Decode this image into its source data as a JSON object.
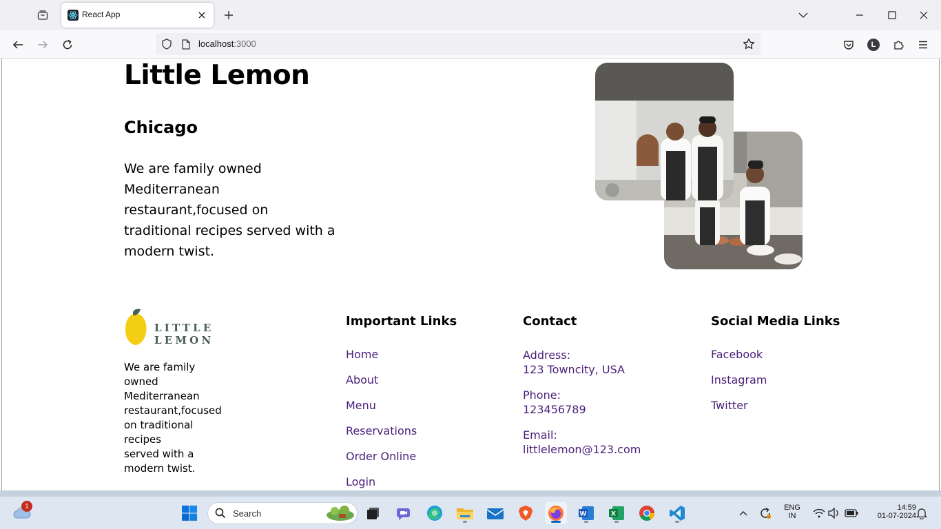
{
  "browser": {
    "tab_title": "React App",
    "url_host": "localhost",
    "url_port": ":3000",
    "profile_initial": "L"
  },
  "hero": {
    "title": "Little Lemon",
    "city": "Chicago",
    "description": "We are family owned Mediterranean restaurant,focused on traditional recipes served with a modern twist."
  },
  "footer": {
    "logo_text": "LITTLE LEMON",
    "description_lines": [
      "We are family",
      "owned",
      "Mediterranean",
      "restaurant,focused",
      "on traditional",
      "recipes",
      "served with a",
      "modern twist."
    ],
    "important_links": {
      "title": "Important Links",
      "items": [
        "Home",
        "About",
        "Menu",
        "Reservations",
        "Order Online",
        "Login"
      ]
    },
    "contact": {
      "title": "Contact",
      "address_label": "Address:",
      "address_value": "123 Towncity, USA",
      "phone_label": "Phone:",
      "phone_value": "123456789",
      "email_label": "Email:",
      "email_value": "littlelemon@123.com"
    },
    "social": {
      "title": "Social Media Links",
      "items": [
        "Facebook",
        "Instagram",
        "Twitter"
      ]
    }
  },
  "taskbar": {
    "weather_badge": "1",
    "search_placeholder": "Search",
    "lang_top": "ENG",
    "lang_bottom": "IN",
    "time": "14:59",
    "date": "01-07-2024"
  },
  "colors": {
    "link": "#4b1f7a",
    "logo_text": "#495e57",
    "lemon": "#f4ce14"
  }
}
